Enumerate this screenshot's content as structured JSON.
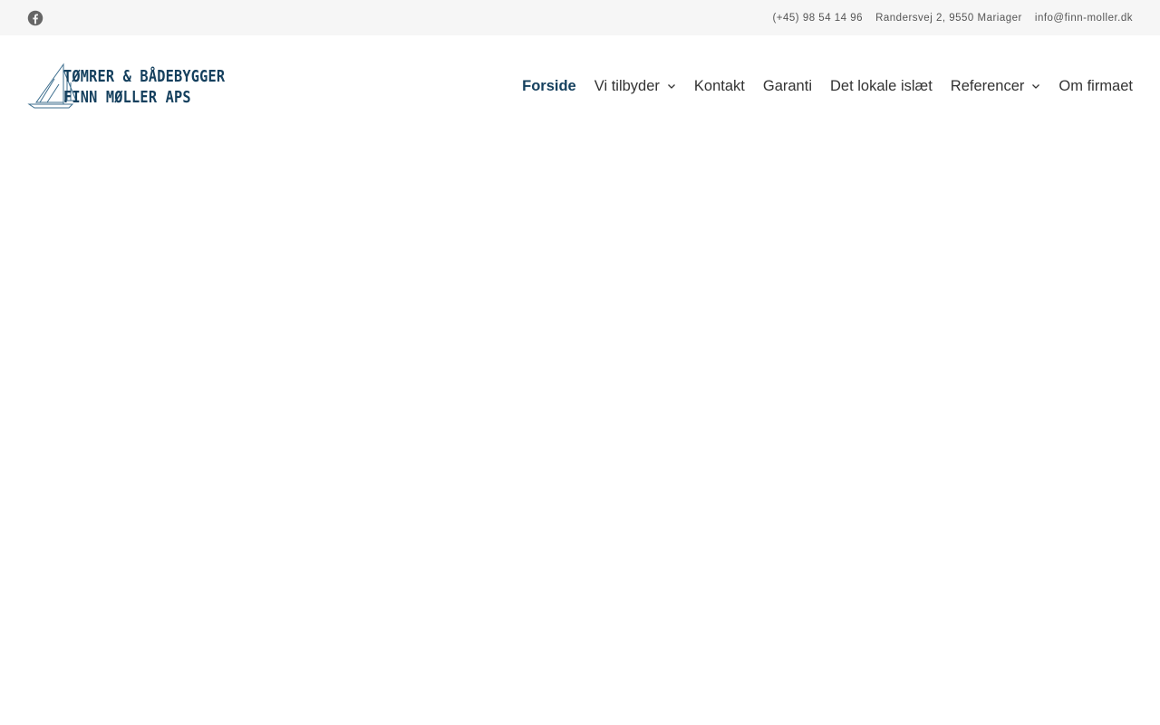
{
  "topbar": {
    "social_icon": "facebook-icon",
    "phone": "(+45) 98 54 14 96",
    "address": "Randersvej 2, 9550 Mariager",
    "email": "info@finn-moller.dk"
  },
  "header": {
    "logo": {
      "icon": "sailboat-icon",
      "line1": "TØMRER & BÅDEBYGGER",
      "line2": "FINN MØLLER APS"
    },
    "nav": {
      "items": [
        {
          "label": "Forside",
          "active": true
        },
        {
          "label": "Vi tilbyder",
          "has_dropdown": true
        },
        {
          "label": "Kontakt"
        },
        {
          "label": "Garanti"
        },
        {
          "label": "Det lokale islæt"
        },
        {
          "label": "Referencer",
          "has_dropdown": true
        },
        {
          "label": "Om firmaet"
        }
      ]
    }
  },
  "colors": {
    "brand": "#15405e",
    "topbar_bg": "#f6f6f6",
    "text": "#333333"
  }
}
